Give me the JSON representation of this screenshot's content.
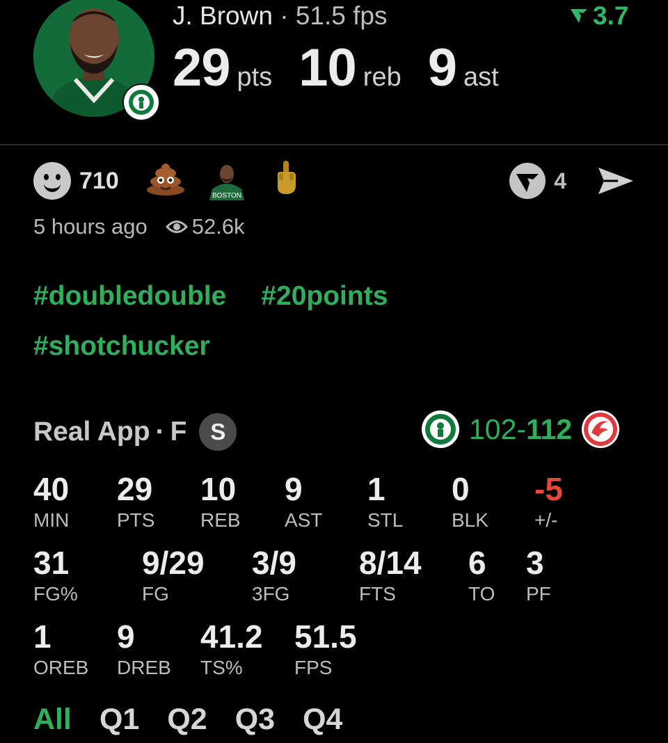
{
  "header": {
    "player_name": "J. Brown",
    "separator": "·",
    "fps_text": "51.5 fps",
    "boost_value": "3.7",
    "stats": [
      {
        "value": "29",
        "unit": "pts"
      },
      {
        "value": "10",
        "unit": "reb"
      },
      {
        "value": "9",
        "unit": "ast"
      }
    ]
  },
  "reactions": {
    "reaction_count": "710",
    "emojis": [
      "poop-emoji",
      "player-emoji",
      "finger-emoji"
    ],
    "share_count": "4",
    "time_ago": "5 hours ago",
    "views": "52.6k"
  },
  "hashtags": [
    "#doubledouble",
    "#20points",
    "#shotchucker"
  ],
  "game": {
    "source": "Real App",
    "separator": "·",
    "status": "F",
    "badge": "S",
    "home_score": "102",
    "dash": "-",
    "away_score": "112"
  },
  "stats": {
    "row1": [
      {
        "value": "40",
        "label": "MIN"
      },
      {
        "value": "29",
        "label": "PTS"
      },
      {
        "value": "10",
        "label": "REB"
      },
      {
        "value": "9",
        "label": "AST"
      },
      {
        "value": "1",
        "label": "STL"
      },
      {
        "value": "0",
        "label": "BLK"
      },
      {
        "value": "-5",
        "label": "+/-"
      }
    ],
    "row2": [
      {
        "value": "31",
        "label": "FG%"
      },
      {
        "value": "9/29",
        "label": "FG"
      },
      {
        "value": "3/9",
        "label": "3FG"
      },
      {
        "value": "8/14",
        "label": "FTS"
      },
      {
        "value": "6",
        "label": "TO"
      },
      {
        "value": "3",
        "label": "PF"
      }
    ],
    "row3": [
      {
        "value": "1",
        "label": "OREB"
      },
      {
        "value": "9",
        "label": "DREB"
      },
      {
        "value": "41.2",
        "label": "TS%"
      },
      {
        "value": "51.5",
        "label": "FPS"
      }
    ]
  },
  "quarters": [
    "All",
    "Q1",
    "Q2",
    "Q3",
    "Q4"
  ],
  "colors": {
    "accent": "#2fae5c",
    "negative": "#e5483b",
    "background": "#000000"
  }
}
